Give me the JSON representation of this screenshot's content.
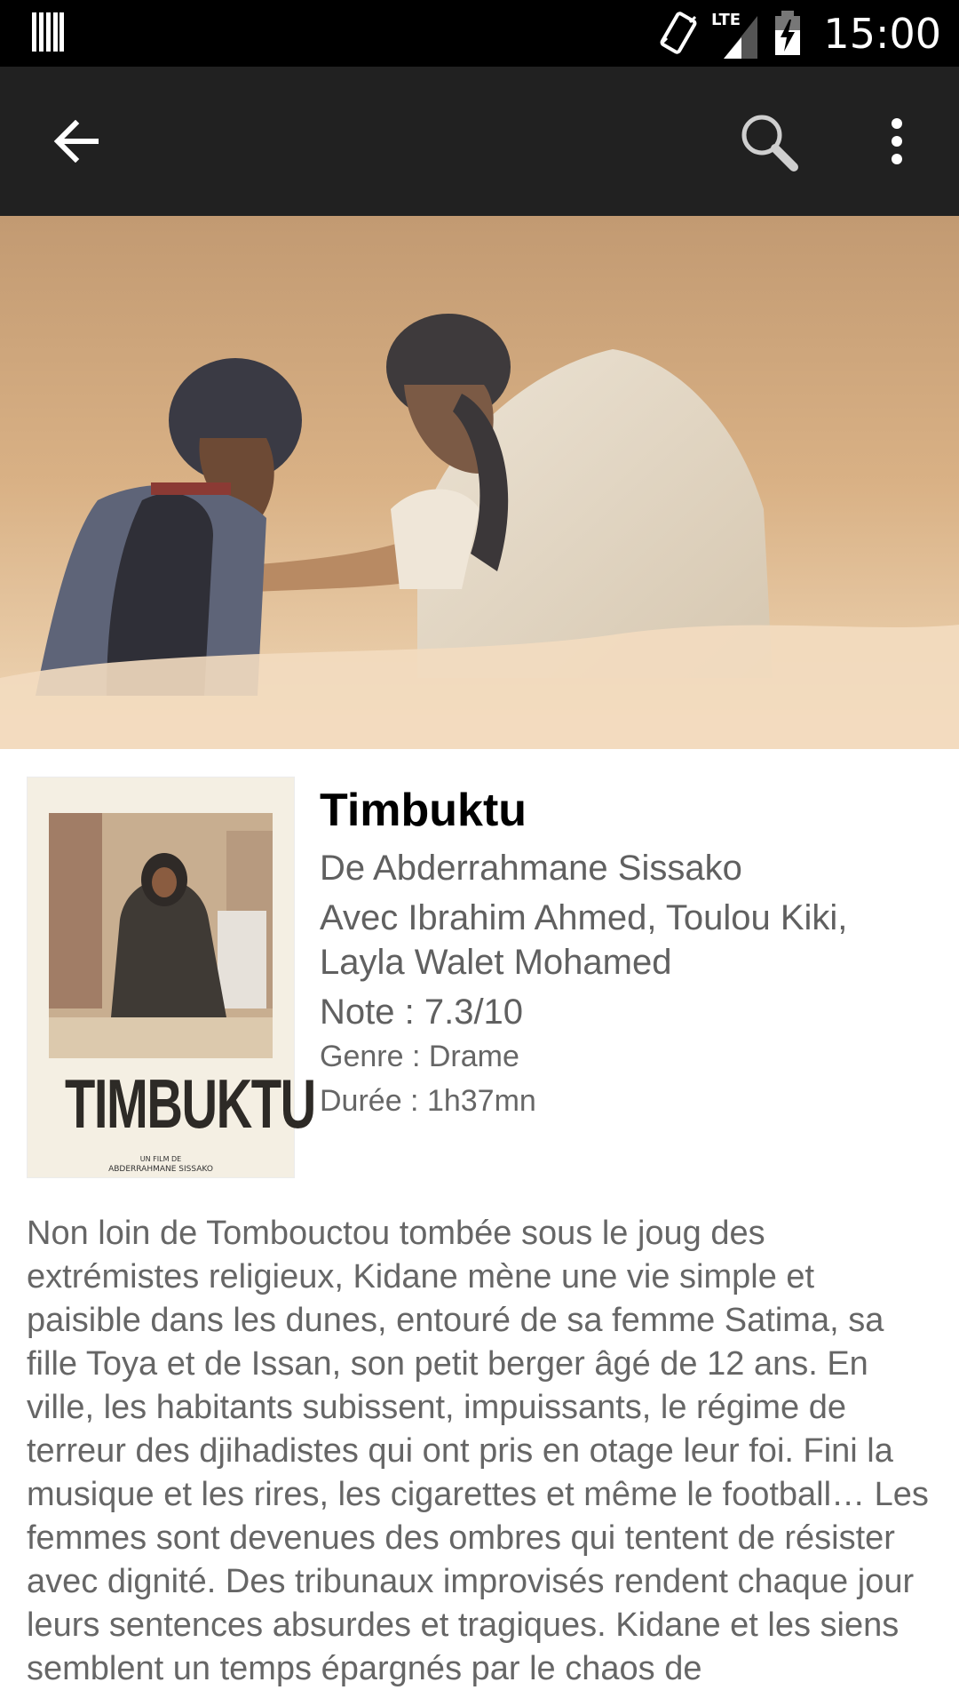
{
  "status_bar": {
    "time": "15:00",
    "network": "LTE",
    "icons": [
      "barcode-icon",
      "vibrate-icon",
      "lte-signal-icon",
      "battery-charging-icon"
    ]
  },
  "app_bar": {
    "icons": [
      "back-arrow-icon",
      "search-icon",
      "more-vert-icon"
    ]
  },
  "poster": {
    "title": "TIMBUKTU",
    "credit_small": "UN FILM DE",
    "credit_name": "ABDERRAHMANE SISSAKO"
  },
  "movie": {
    "title": "Timbuktu",
    "director": "De Abderrahmane Sissako",
    "cast": "Avec Ibrahim Ahmed, Toulou Kiki, Layla Walet Mohamed",
    "rating": "Note : 7.3/10",
    "genre": "Genre : Drame",
    "duration": "Durée : 1h37mn"
  },
  "synopsis": "Non loin de Tombouctou tombée sous le joug des extrémistes religieux, Kidane  mène une vie simple et paisible dans les dunes, entouré de sa femme Satima, sa fille Toya et de Issan, son petit berger âgé de 12 ans.  En ville, les habitants subissent, impuissants, le régime de terreur des djihadistes qui ont pris en otage leur foi. Fini la musique et les rires, les cigarettes et même le football… Les femmes sont devenues des ombres qui tentent de résister avec dignité. Des tribunaux improvisés rendent chaque jour leurs sentences absurdes et tragiques.  Kidane et les siens semblent un temps épargnés par le chaos de"
}
